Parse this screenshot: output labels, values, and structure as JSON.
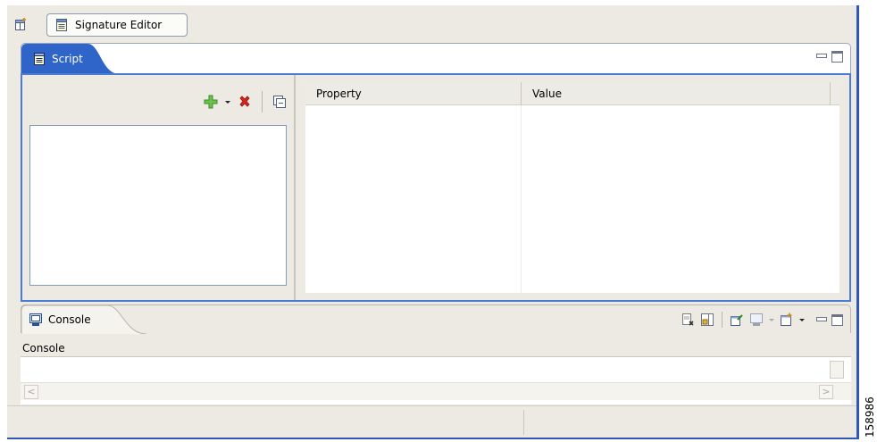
{
  "perspective": {
    "open_icon": "open-perspective-icon",
    "button_label": "Signature Editor",
    "button_icon": "signature-editor-icon"
  },
  "script_view": {
    "tab_label": "Script",
    "tab_icon": "script-icon",
    "accent_color": "#2f64c8",
    "toolbar": {
      "add_icon": "add-plus-icon",
      "dropdown_icon": "chevron-down-icon",
      "delete_icon": "delete-x-icon",
      "collapse_icon": "collapse-all-icon"
    },
    "table": {
      "columns": [
        "Property",
        "Value"
      ]
    }
  },
  "console_view": {
    "tab_label": "Console",
    "tab_icon": "console-icon",
    "label": "Console",
    "toolbar": [
      "clear-console-icon",
      "scroll-lock-icon",
      "pin-console-icon",
      "display-console-icon",
      "open-console-icon"
    ]
  },
  "figure_id": "158986"
}
